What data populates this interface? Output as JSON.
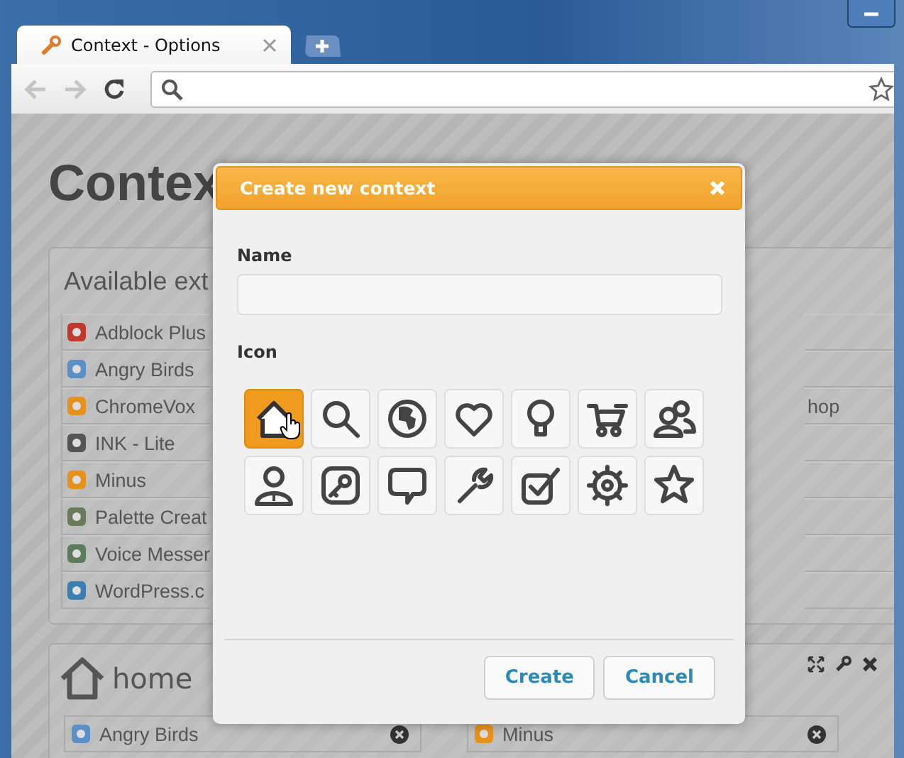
{
  "browser": {
    "tab": {
      "title": "Context - Options"
    }
  },
  "page": {
    "title": "Contex",
    "extensions": {
      "title": "Available ext",
      "items": [
        {
          "name": "Adblock Plus",
          "color": "#c0392b"
        },
        {
          "name": "Angry Birds",
          "color": "#5b8fc7"
        },
        {
          "name": "ChromeVox",
          "color": "#e8901c"
        },
        {
          "name": "INK - Lite",
          "color": "#555555"
        },
        {
          "name": "Minus",
          "color": "#e8901c"
        },
        {
          "name": "Palette Creat",
          "color": "#6a7a5a"
        },
        {
          "name": "Voice Messer",
          "color": "#5c7a5c"
        },
        {
          "name": "WordPress.c",
          "color": "#3b7fb0"
        }
      ],
      "right_rows": [
        {},
        {},
        {
          "name": "hop"
        },
        {},
        {},
        {},
        {},
        {}
      ]
    },
    "context": {
      "title": "home",
      "items": [
        {
          "name": "Angry Birds",
          "color": "#5b8fc7"
        },
        {
          "name": "Minus",
          "color": "#e8901c"
        }
      ]
    }
  },
  "dialog": {
    "title": "Create new context",
    "name_label": "Name",
    "icon_label": "Icon",
    "icons": [
      {
        "kind": "house",
        "selected": true
      },
      {
        "kind": "search",
        "selected": false
      },
      {
        "kind": "globe",
        "selected": false
      },
      {
        "kind": "heart",
        "selected": false
      },
      {
        "kind": "bulb",
        "selected": false
      },
      {
        "kind": "cart",
        "selected": false
      },
      {
        "kind": "users",
        "selected": false
      },
      {
        "kind": "user",
        "selected": false
      },
      {
        "kind": "key",
        "selected": false
      },
      {
        "kind": "speech",
        "selected": false
      },
      {
        "kind": "wrench",
        "selected": false
      },
      {
        "kind": "checkbox",
        "selected": false
      },
      {
        "kind": "gear",
        "selected": false
      },
      {
        "kind": "star",
        "selected": false
      }
    ],
    "buttons": [
      {
        "label": "Create"
      },
      {
        "label": "Cancel"
      }
    ]
  }
}
